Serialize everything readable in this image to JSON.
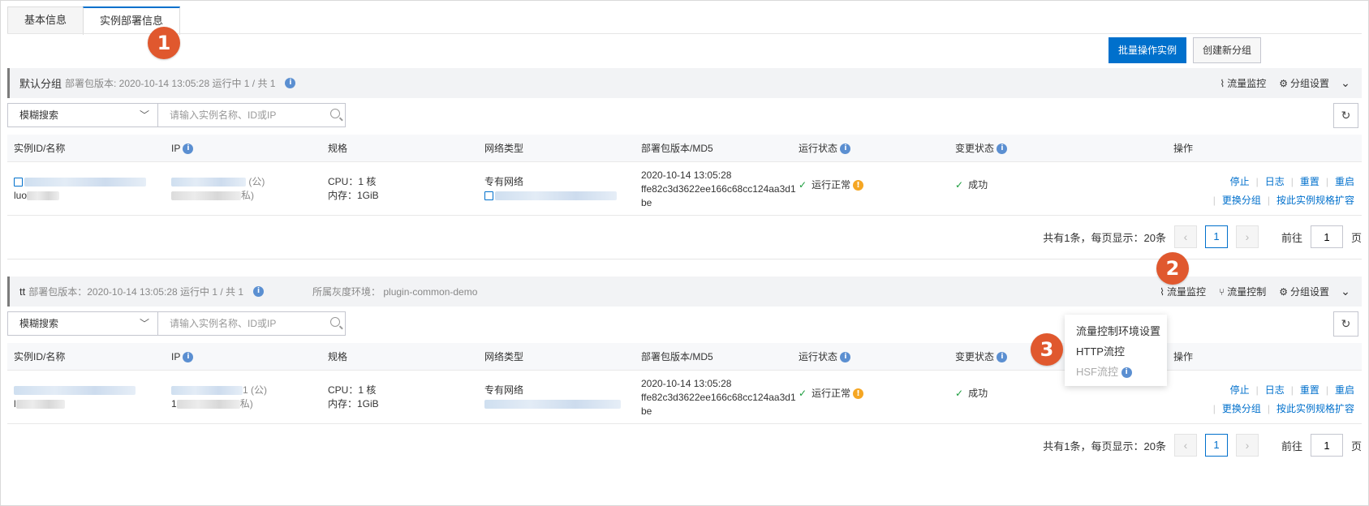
{
  "tabs": [
    {
      "label": "基本信息",
      "active": false
    },
    {
      "label": "实例部署信息",
      "active": true
    }
  ],
  "callouts": [
    "1",
    "2",
    "3"
  ],
  "toolbar": {
    "batch_label": "批量操作实例",
    "create_label": "创建新分组"
  },
  "search": {
    "select_value": "模糊搜索",
    "placeholder": "请输入实例名称、ID或IP"
  },
  "columns": [
    "实例ID/名称",
    "IP",
    "规格",
    "网络类型",
    "部署包版本/MD5",
    "运行状态",
    "变更状态",
    "操作"
  ],
  "group_actions": {
    "monitor": "流量监控",
    "control": "流量控制",
    "settings": "分组设置"
  },
  "groups": [
    {
      "name": "默认分组",
      "meta": "部署包版本: 2020-10-14 13:05:28   运行中 1 / 共 1",
      "env": "",
      "row": {
        "id_prefix": "",
        "name_prefix": "luo",
        "ip_public_suffix": "(公)",
        "ip_private_suffix": "私)",
        "cpu": "CPU：1 核",
        "mem": "内存：1GiB",
        "network": "专有网络",
        "version": "2020-10-14 13:05:28",
        "md5": "ffe82c3d3622ee166c68cc124aa3d1",
        "md5_end": "be",
        "run_status": "运行正常",
        "change_status": "成功",
        "ops_row1": [
          "停止",
          "日志",
          "重置",
          "重启"
        ],
        "ops_row2": [
          "更换分组",
          "按此实例规格扩容"
        ]
      },
      "pager": {
        "summary": "共有1条，每页显示：20条",
        "page": "1",
        "goto_prefix": "前往",
        "goto_value": "1",
        "goto_suffix": "页"
      }
    },
    {
      "name": "tt",
      "meta": "部署包版本：2020-10-14 13:05:28   运行中 1 / 共 1",
      "env": "所属灰度环境：  plugin-common-demo",
      "row": {
        "id_prefix": "",
        "name_prefix": "l",
        "ip_public_suffix": "1   (公)",
        "ip_private_suffix": "私)",
        "private_prefix": "1",
        "cpu": "CPU：1 核",
        "mem": "内存：1GiB",
        "network": "专有网络",
        "version": "2020-10-14 13:05:28",
        "md5": "ffe82c3d3622ee166c68cc124aa3d1",
        "md5_end": "be",
        "run_status": "运行正常",
        "change_status": "成功",
        "ops_row1": [
          "停止",
          "日志",
          "重置",
          "重启"
        ],
        "ops_row2": [
          "更换分组",
          "按此实例规格扩容"
        ]
      },
      "pager": {
        "summary": "共有1条，每页显示：20条",
        "page": "1",
        "goto_prefix": "前往",
        "goto_value": "1",
        "goto_suffix": "页"
      }
    }
  ],
  "dropdown": {
    "items": [
      "流量控制环境设置",
      "HTTP流控",
      "HSF流控"
    ]
  }
}
